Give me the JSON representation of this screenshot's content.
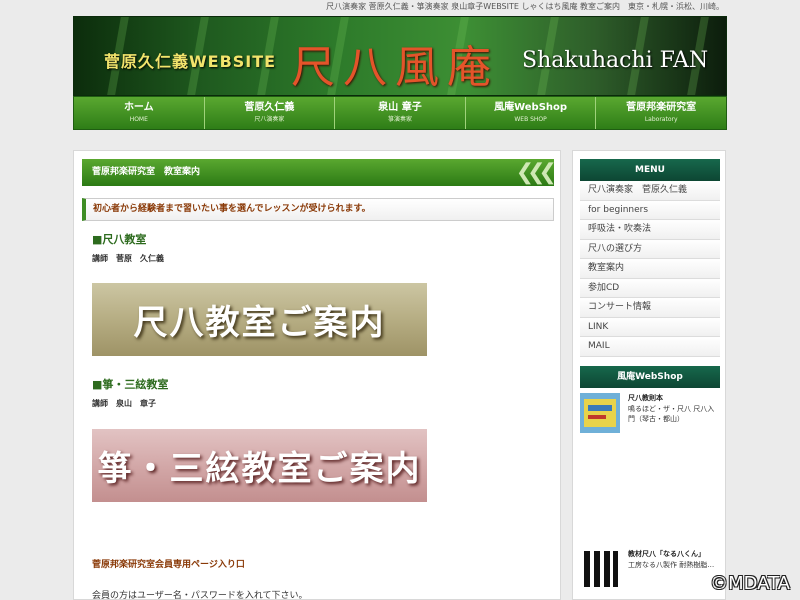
{
  "topline": "尺八演奏家 菅原久仁義・箏演奏家 泉山章子WEBSITE しゃくはち風庵 教室ご案内　東京・札幌・浜松、川崎。",
  "banner": {
    "title_jp": "菅原久仁義WEBSITE",
    "title_big": "尺八風庵",
    "title_en": "Shakuhachi FAN"
  },
  "nav": [
    {
      "label": "ホーム",
      "sub": "HOME"
    },
    {
      "label": "菅原久仁義",
      "sub": "尺八演奏家"
    },
    {
      "label": "泉山 章子",
      "sub": "箏演奏家"
    },
    {
      "label": "風庵WebShop",
      "sub": "WEB SHOP"
    },
    {
      "label": "菅原邦楽研究室",
      "sub": "Laboratory"
    }
  ],
  "main": {
    "header": "菅原邦楽研究室　教室案内",
    "notice": "初心者から経験者まで習いたい事を選んでレッスンが受けられます。",
    "section1": {
      "title": "■尺八教室",
      "teacher": "講師　菅原　久仁義",
      "banner": "尺八教室ご案内"
    },
    "section2": {
      "title": "■箏・三絃教室",
      "teacher": "講師　泉山　章子",
      "banner": "箏・三絃教室ご案内"
    },
    "members_link": "菅原邦楽研究室会員専用ページ入り口",
    "members_desc": "会員の方はユーザー名・パスワードを入れて下さい。"
  },
  "sidebar": {
    "menu_title": "MENU",
    "menu": [
      "尺八演奏家　菅原久仁義",
      "for beginners",
      "呼吸法・吹奏法",
      "尺八の選び方",
      "教室案内",
      "参加CD",
      "コンサート情報",
      "LINK",
      "MAIL"
    ],
    "shop_title": "風庵WebShop",
    "shop_items": [
      {
        "title": "尺八教則本",
        "desc": "鳴るほど・ザ・尺八 尺八入門（琴古・都山）"
      },
      {
        "title": "教材尺八「なる八くん」",
        "desc": "工房なる八製作 耐熱樹脂…"
      }
    ]
  },
  "watermark": "©MDATA"
}
